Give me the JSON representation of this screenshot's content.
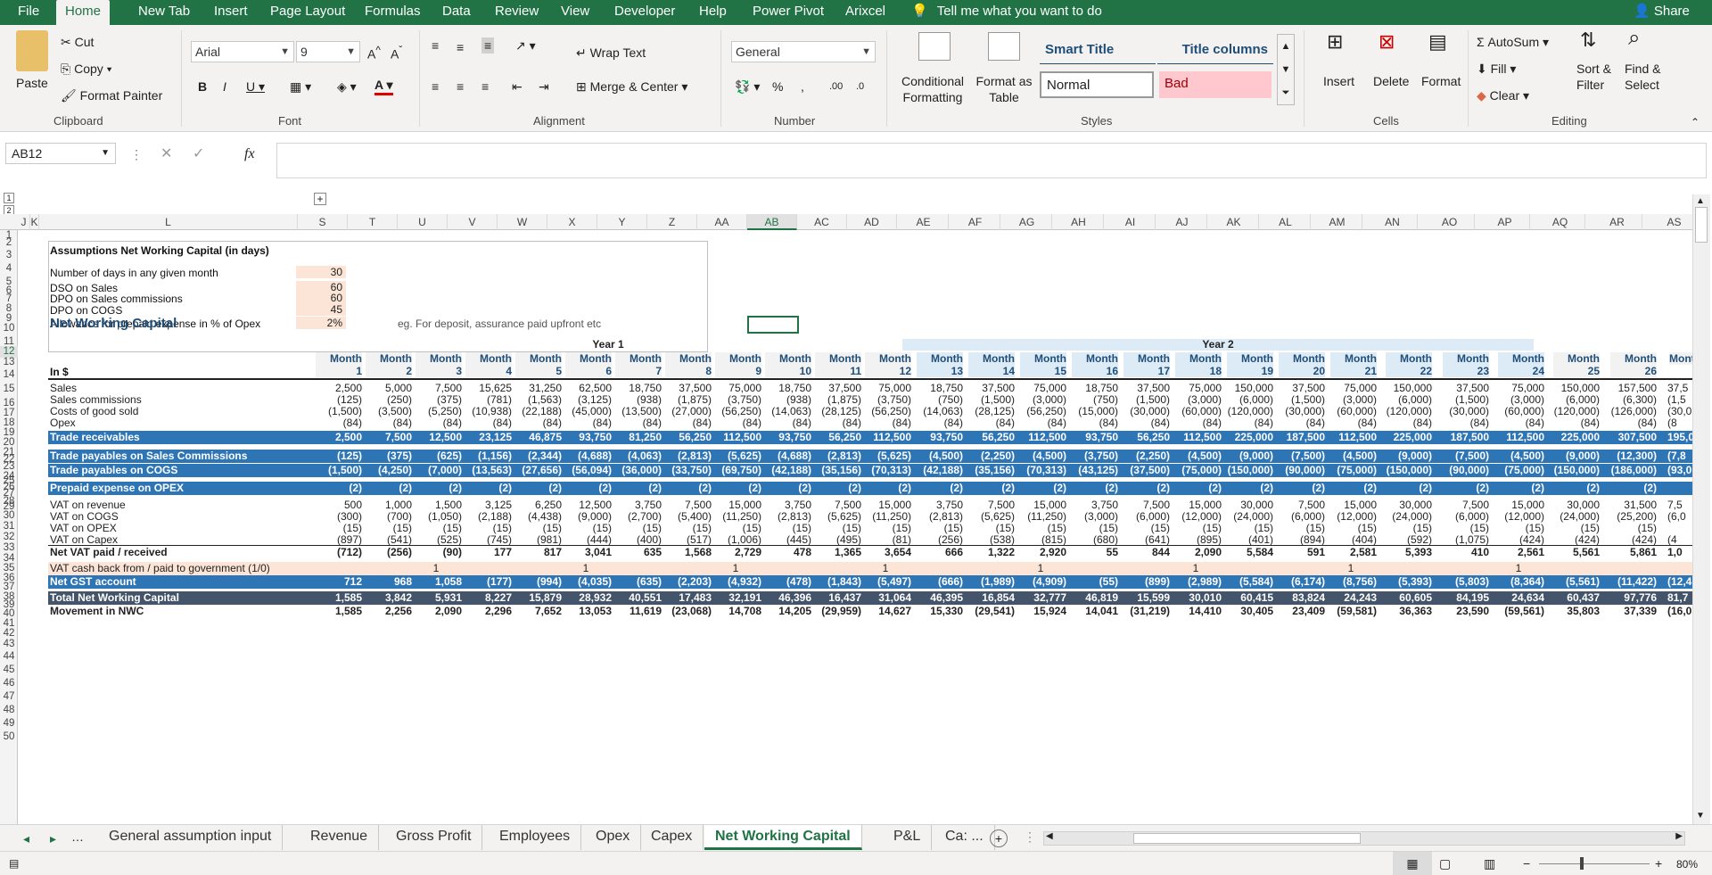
{
  "menu": {
    "file": "File",
    "tabs": [
      "Home",
      "New Tab",
      "Insert",
      "Page Layout",
      "Formulas",
      "Data",
      "Review",
      "View",
      "Developer",
      "Help",
      "Power Pivot",
      "Arixcel"
    ],
    "tell": "Tell me what you want to do",
    "share": "Share"
  },
  "ribbon": {
    "clipboard": {
      "label": "Clipboard",
      "paste": "Paste",
      "cut": "Cut",
      "copy": "Copy",
      "format_painter": "Format Painter"
    },
    "font": {
      "label": "Font",
      "name": "Arial",
      "size": "9"
    },
    "alignment": {
      "label": "Alignment",
      "wrap": "Wrap Text",
      "merge": "Merge & Center"
    },
    "number": {
      "label": "Number",
      "format": "General"
    },
    "styles": {
      "label": "Styles",
      "cond": "Conditional Formatting",
      "fmt_table": "Format as Table",
      "smart_title": "Smart Title",
      "title_columns": "Title columns",
      "normal": "Normal",
      "bad": "Bad"
    },
    "cells": {
      "label": "Cells",
      "insert": "Insert",
      "delete": "Delete",
      "format": "Format"
    },
    "editing": {
      "label": "Editing",
      "autosum": "AutoSum",
      "fill": "Fill",
      "clear": "Clear",
      "sort": "Sort & Filter",
      "find": "Find & Select"
    }
  },
  "formula": {
    "namebox": "AB12",
    "fx": "fx",
    "value": ""
  },
  "columns": [
    "J",
    "K",
    "L",
    "S",
    "T",
    "U",
    "V",
    "W",
    "X",
    "Y",
    "Z",
    "AA",
    "AB",
    "AC",
    "AD",
    "AE",
    "AF",
    "AG",
    "AH",
    "AI",
    "AJ",
    "AK",
    "AL",
    "AM",
    "AN",
    "AO",
    "AP",
    "AQ",
    "AR",
    "AS"
  ],
  "selected_column": "AB",
  "rows": [
    "1",
    "2",
    "3",
    "4",
    "5",
    "6",
    "7",
    "8",
    "9",
    "10",
    "11",
    "12",
    "13",
    "14",
    "15",
    "16",
    "17",
    "18",
    "19",
    "20",
    "21",
    "22",
    "23",
    "24",
    "25",
    "26",
    "27",
    "28",
    "29",
    "30",
    "31",
    "32",
    "33",
    "34",
    "35",
    "36",
    "37",
    "38",
    "39",
    "40",
    "41",
    "42",
    "43",
    "44",
    "45",
    "46",
    "47",
    "48",
    "49",
    "50"
  ],
  "selected_row": "12",
  "assumptions": {
    "title": "Assumptions Net Working Capital (in days)",
    "items": [
      {
        "label": "Number of days in any given month",
        "value": "30"
      },
      {
        "label": "DSO on Sales",
        "value": "60"
      },
      {
        "label": "DPO on Sales commissions",
        "value": "60"
      },
      {
        "label": "DPO on COGS",
        "value": "45"
      },
      {
        "label": "Allowance for prepaid expense in % of Opex",
        "value": "2%",
        "note": "eg. For deposit, assurance paid upfront etc"
      }
    ]
  },
  "nwc": {
    "title": "Net Working Capital",
    "year1": "Year 1",
    "year2": "Year 2",
    "unit": "In $",
    "month_word": "Month",
    "months": [
      "1",
      "2",
      "3",
      "4",
      "5",
      "6",
      "7",
      "8",
      "9",
      "10",
      "11",
      "12",
      "13",
      "14",
      "15",
      "16",
      "17",
      "18",
      "19",
      "20",
      "21",
      "22",
      "23",
      "24",
      "25",
      "26"
    ],
    "rows": [
      {
        "label": "Sales",
        "style": "",
        "values": [
          "2,500",
          "5,000",
          "7,500",
          "15,625",
          "31,250",
          "62,500",
          "18,750",
          "37,500",
          "75,000",
          "18,750",
          "37,500",
          "75,000",
          "18,750",
          "37,500",
          "75,000",
          "18,750",
          "37,500",
          "75,000",
          "150,000",
          "37,500",
          "75,000",
          "150,000",
          "37,500",
          "75,000",
          "150,000",
          "157,500",
          "37,5"
        ]
      },
      {
        "label": "Sales commissions",
        "style": "",
        "values": [
          "(125)",
          "(250)",
          "(375)",
          "(781)",
          "(1,563)",
          "(3,125)",
          "(938)",
          "(1,875)",
          "(3,750)",
          "(938)",
          "(1,875)",
          "(3,750)",
          "(750)",
          "(1,500)",
          "(3,000)",
          "(750)",
          "(1,500)",
          "(3,000)",
          "(6,000)",
          "(1,500)",
          "(3,000)",
          "(6,000)",
          "(1,500)",
          "(3,000)",
          "(6,000)",
          "(6,300)",
          "(1,5"
        ]
      },
      {
        "label": "Costs of good sold",
        "style": "",
        "values": [
          "(1,500)",
          "(3,500)",
          "(5,250)",
          "(10,938)",
          "(22,188)",
          "(45,000)",
          "(13,500)",
          "(27,000)",
          "(56,250)",
          "(14,063)",
          "(28,125)",
          "(56,250)",
          "(14,063)",
          "(28,125)",
          "(56,250)",
          "(15,000)",
          "(30,000)",
          "(60,000)",
          "(120,000)",
          "(30,000)",
          "(60,000)",
          "(120,000)",
          "(30,000)",
          "(60,000)",
          "(120,000)",
          "(126,000)",
          "(30,0"
        ]
      },
      {
        "label": "Opex",
        "style": "",
        "values": [
          "(84)",
          "(84)",
          "(84)",
          "(84)",
          "(84)",
          "(84)",
          "(84)",
          "(84)",
          "(84)",
          "(84)",
          "(84)",
          "(84)",
          "(84)",
          "(84)",
          "(84)",
          "(84)",
          "(84)",
          "(84)",
          "(84)",
          "(84)",
          "(84)",
          "(84)",
          "(84)",
          "(84)",
          "(84)",
          "(84)",
          "(8"
        ]
      },
      {
        "label": "Trade receivables",
        "style": "band",
        "values": [
          "2,500",
          "7,500",
          "12,500",
          "23,125",
          "46,875",
          "93,750",
          "81,250",
          "56,250",
          "112,500",
          "93,750",
          "56,250",
          "112,500",
          "93,750",
          "56,250",
          "112,500",
          "93,750",
          "56,250",
          "112,500",
          "225,000",
          "187,500",
          "112,500",
          "225,000",
          "187,500",
          "112,500",
          "225,000",
          "307,500",
          "195,0"
        ]
      },
      {
        "label": "Trade payables on Sales Commissions",
        "style": "band",
        "values": [
          "(125)",
          "(375)",
          "(625)",
          "(1,156)",
          "(2,344)",
          "(4,688)",
          "(4,063)",
          "(2,813)",
          "(5,625)",
          "(4,688)",
          "(2,813)",
          "(5,625)",
          "(4,500)",
          "(2,250)",
          "(4,500)",
          "(3,750)",
          "(2,250)",
          "(4,500)",
          "(9,000)",
          "(7,500)",
          "(4,500)",
          "(9,000)",
          "(7,500)",
          "(4,500)",
          "(9,000)",
          "(12,300)",
          "(7,8"
        ]
      },
      {
        "label": "Trade payables on COGS",
        "style": "band",
        "values": [
          "(1,500)",
          "(4,250)",
          "(7,000)",
          "(13,563)",
          "(27,656)",
          "(56,094)",
          "(36,000)",
          "(33,750)",
          "(69,750)",
          "(42,188)",
          "(35,156)",
          "(70,313)",
          "(42,188)",
          "(35,156)",
          "(70,313)",
          "(43,125)",
          "(37,500)",
          "(75,000)",
          "(150,000)",
          "(90,000)",
          "(75,000)",
          "(150,000)",
          "(90,000)",
          "(75,000)",
          "(150,000)",
          "(186,000)",
          "(93,0"
        ]
      },
      {
        "label": "Prepaid expense on OPEX",
        "style": "band",
        "values": [
          "(2)",
          "(2)",
          "(2)",
          "(2)",
          "(2)",
          "(2)",
          "(2)",
          "(2)",
          "(2)",
          "(2)",
          "(2)",
          "(2)",
          "(2)",
          "(2)",
          "(2)",
          "(2)",
          "(2)",
          "(2)",
          "(2)",
          "(2)",
          "(2)",
          "(2)",
          "(2)",
          "(2)",
          "(2)",
          "(2)",
          ""
        ]
      },
      {
        "label": "VAT on revenue",
        "style": "",
        "values": [
          "500",
          "1,000",
          "1,500",
          "3,125",
          "6,250",
          "12,500",
          "3,750",
          "7,500",
          "15,000",
          "3,750",
          "7,500",
          "15,000",
          "3,750",
          "7,500",
          "15,000",
          "3,750",
          "7,500",
          "15,000",
          "30,000",
          "7,500",
          "15,000",
          "30,000",
          "7,500",
          "15,000",
          "30,000",
          "31,500",
          "7,5"
        ]
      },
      {
        "label": "VAT on COGS",
        "style": "",
        "values": [
          "(300)",
          "(700)",
          "(1,050)",
          "(2,188)",
          "(4,438)",
          "(9,000)",
          "(2,700)",
          "(5,400)",
          "(11,250)",
          "(2,813)",
          "(5,625)",
          "(11,250)",
          "(2,813)",
          "(5,625)",
          "(11,250)",
          "(3,000)",
          "(6,000)",
          "(12,000)",
          "(24,000)",
          "(6,000)",
          "(12,000)",
          "(24,000)",
          "(6,000)",
          "(12,000)",
          "(24,000)",
          "(25,200)",
          "(6,0"
        ]
      },
      {
        "label": "VAT on OPEX",
        "style": "",
        "values": [
          "(15)",
          "(15)",
          "(15)",
          "(15)",
          "(15)",
          "(15)",
          "(15)",
          "(15)",
          "(15)",
          "(15)",
          "(15)",
          "(15)",
          "(15)",
          "(15)",
          "(15)",
          "(15)",
          "(15)",
          "(15)",
          "(15)",
          "(15)",
          "(15)",
          "(15)",
          "(15)",
          "(15)",
          "(15)",
          "(15)",
          ""
        ]
      },
      {
        "label": "VAT on Capex",
        "style": "",
        "values": [
          "(897)",
          "(541)",
          "(525)",
          "(745)",
          "(981)",
          "(444)",
          "(400)",
          "(517)",
          "(1,006)",
          "(445)",
          "(495)",
          "(81)",
          "(256)",
          "(538)",
          "(815)",
          "(680)",
          "(641)",
          "(895)",
          "(401)",
          "(894)",
          "(404)",
          "(592)",
          "(1,075)",
          "(424)",
          "(424)",
          "(424)",
          "(4"
        ]
      },
      {
        "label": "Net VAT paid / received",
        "style": "bold",
        "values": [
          "(712)",
          "(256)",
          "(90)",
          "177",
          "817",
          "3,041",
          "635",
          "1,568",
          "2,729",
          "478",
          "1,365",
          "3,654",
          "666",
          "1,322",
          "2,920",
          "55",
          "844",
          "2,090",
          "5,584",
          "591",
          "2,581",
          "5,393",
          "410",
          "2,561",
          "5,561",
          "5,861",
          "1,0"
        ]
      },
      {
        "label": "VAT cash back from / paid to government (1/0)",
        "style": "peachrow",
        "values": [
          "",
          "",
          "1",
          "",
          "",
          "1",
          "",
          "",
          "1",
          "",
          "",
          "1",
          "",
          "",
          "1",
          "",
          "",
          "1",
          "",
          "",
          "1",
          "",
          "",
          "1",
          "",
          "",
          ""
        ]
      },
      {
        "label": "Net GST account",
        "style": "band",
        "values": [
          "712",
          "968",
          "1,058",
          "(177)",
          "(994)",
          "(4,035)",
          "(635)",
          "(2,203)",
          "(4,932)",
          "(478)",
          "(1,843)",
          "(5,497)",
          "(666)",
          "(1,989)",
          "(4,909)",
          "(55)",
          "(899)",
          "(2,989)",
          "(5,584)",
          "(6,174)",
          "(8,756)",
          "(5,393)",
          "(5,803)",
          "(8,364)",
          "(5,561)",
          "(11,422)",
          "(12,4"
        ]
      },
      {
        "label": "Total Net Working Capital",
        "style": "dark",
        "values": [
          "1,585",
          "3,842",
          "5,931",
          "8,227",
          "15,879",
          "28,932",
          "40,551",
          "17,483",
          "32,191",
          "46,396",
          "16,437",
          "31,064",
          "46,395",
          "16,854",
          "32,777",
          "46,819",
          "15,599",
          "30,010",
          "60,415",
          "83,824",
          "24,243",
          "60,605",
          "84,195",
          "24,634",
          "60,437",
          "97,776",
          "81,7"
        ]
      },
      {
        "label": "Movement in NWC",
        "style": "bold",
        "values": [
          "1,585",
          "2,256",
          "2,090",
          "2,296",
          "7,652",
          "13,053",
          "11,619",
          "(23,068)",
          "14,708",
          "14,205",
          "(29,959)",
          "14,627",
          "15,330",
          "(29,541)",
          "15,924",
          "14,041",
          "(31,219)",
          "14,410",
          "30,405",
          "23,409",
          "(59,581)",
          "36,363",
          "23,590",
          "(59,561)",
          "35,803",
          "37,339",
          "(16,0"
        ]
      }
    ]
  },
  "sheets": [
    "General assumption input",
    "Revenue",
    "Gross Profit",
    "Employees",
    "Opex",
    "Capex",
    "Net Working Capital",
    "P&L",
    "Ca: ..."
  ],
  "active_sheet": "Net Working Capital",
  "status": {
    "zoom": "80%"
  },
  "colors": {
    "excel_green": "#217346",
    "band_blue": "#2e75b6",
    "dark_band": "#44546a",
    "peach": "#fce4d6",
    "year2_band": "#ddebf7"
  }
}
